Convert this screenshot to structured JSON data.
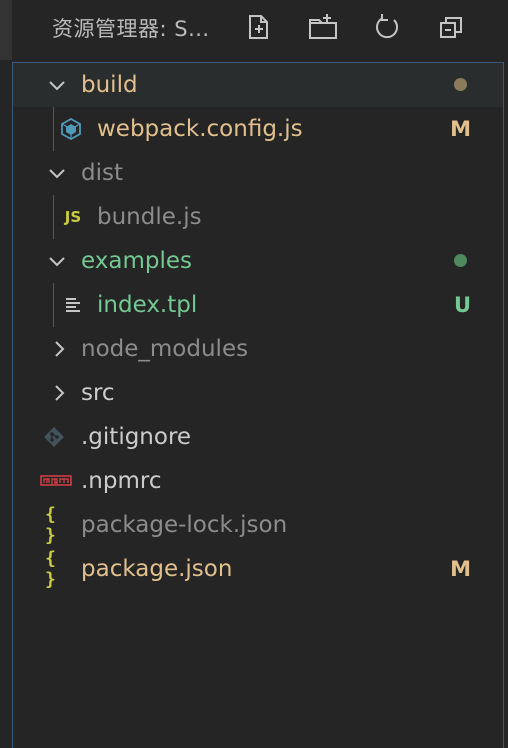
{
  "header": {
    "title": "资源管理器: S...",
    "actions": [
      {
        "name": "new-file-button",
        "icon": "new-file-icon"
      },
      {
        "name": "new-folder-button",
        "icon": "new-folder-icon"
      },
      {
        "name": "refresh-button",
        "icon": "refresh-icon"
      },
      {
        "name": "collapse-all-button",
        "icon": "collapse-all-icon"
      }
    ]
  },
  "tree": {
    "items": [
      {
        "label": "build",
        "type": "folder",
        "expanded": true,
        "status": "modified-dot",
        "dot_color": "#8c7b5a"
      },
      {
        "label": "webpack.config.js",
        "type": "file",
        "icon": "webpack-icon",
        "status": "modified",
        "decoration": "M"
      },
      {
        "label": "dist",
        "type": "folder",
        "expanded": true,
        "status": "ignored"
      },
      {
        "label": "bundle.js",
        "type": "file",
        "icon": "js-icon",
        "icon_text": "JS",
        "status": "ignored"
      },
      {
        "label": "examples",
        "type": "folder",
        "expanded": true,
        "status": "untracked-dot",
        "dot_color": "#4e8a5e"
      },
      {
        "label": "index.tpl",
        "type": "file",
        "icon": "text-file-icon",
        "status": "untracked",
        "decoration": "U"
      },
      {
        "label": "node_modules",
        "type": "folder",
        "expanded": false,
        "status": "ignored"
      },
      {
        "label": "src",
        "type": "folder",
        "expanded": false,
        "status": "normal"
      },
      {
        "label": ".gitignore",
        "type": "file",
        "icon": "git-icon",
        "status": "normal"
      },
      {
        "label": ".npmrc",
        "type": "file",
        "icon": "npm-icon",
        "icon_text": "npm",
        "status": "normal"
      },
      {
        "label": "package-lock.json",
        "type": "file",
        "icon": "json-icon",
        "icon_text": "{ }",
        "status": "ignored"
      },
      {
        "label": "package.json",
        "type": "file",
        "icon": "json-icon",
        "icon_text": "{ }",
        "status": "modified",
        "decoration": "M"
      }
    ]
  },
  "colors": {
    "background": "#252526",
    "modified": "#e2c08d",
    "untracked": "#73c991",
    "ignored": "#8c8c8c",
    "normal": "#cccccc",
    "focus_border": "#3a5a7c"
  }
}
